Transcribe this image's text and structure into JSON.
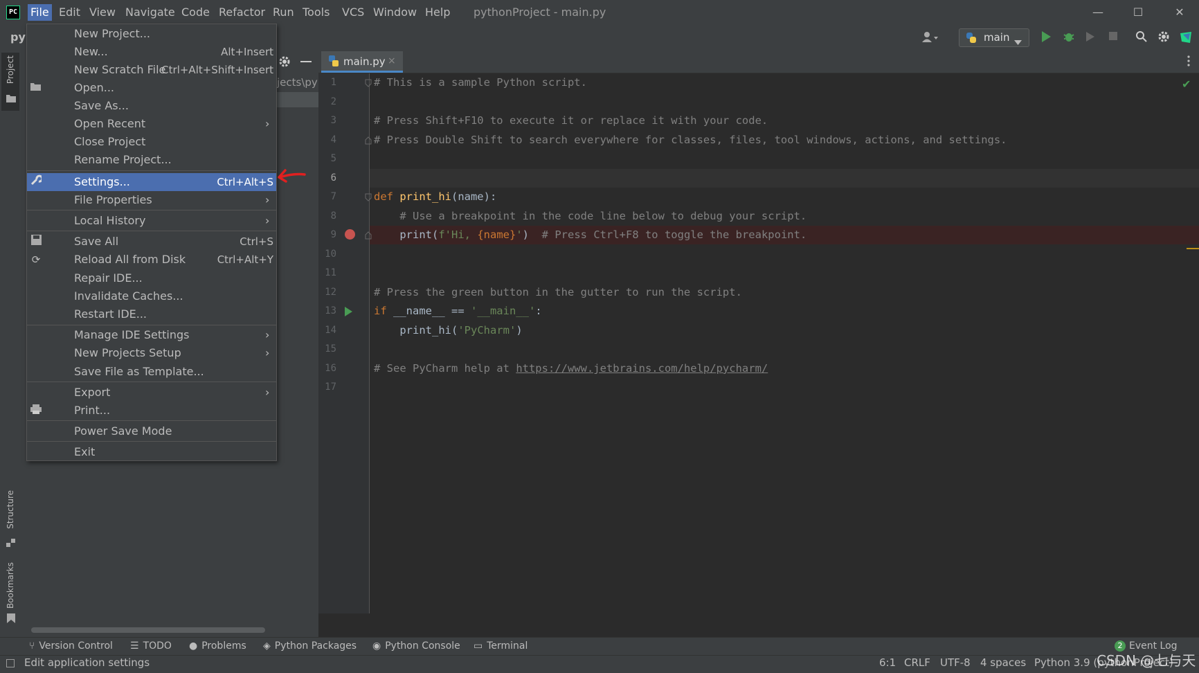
{
  "titlebar": {
    "logo": "PC",
    "menus": [
      "File",
      "Edit",
      "View",
      "Navigate",
      "Code",
      "Refactor",
      "Run",
      "Tools",
      "VCS",
      "Window",
      "Help"
    ],
    "window_title": "pythonProject - main.py",
    "minimize": "—",
    "maximize": "☐",
    "close": "✕"
  },
  "toolbar": {
    "project_short": "py",
    "run_config": "main",
    "icons": [
      "user-icon",
      "python-icon",
      "run-icon",
      "debug-icon",
      "coverage-icon",
      "stop-icon",
      "search-icon",
      "gear-icon",
      "jetbrains-toolbox-icon"
    ]
  },
  "left_stripe": {
    "project": "Project",
    "structure": "Structure",
    "bookmarks": "Bookmarks"
  },
  "project_panel": {
    "path": "jects\\py"
  },
  "editor": {
    "tab_label": "main.py",
    "tab_close": "×",
    "line_numbers": [
      "1",
      "2",
      "3",
      "4",
      "5",
      "6",
      "7",
      "8",
      "9",
      "10",
      "11",
      "12",
      "13",
      "14",
      "15",
      "16",
      "17"
    ],
    "current_line": 6,
    "breakpoint_line": 9,
    "run_line": 13,
    "lines": {
      "l1": "# This is a sample Python script.",
      "l3": "# Press Shift+F10 to execute it or replace it with your code.",
      "l4": "# Press Double Shift to search everywhere for classes, files, tool windows, actions, and settings.",
      "l7_kw": "def ",
      "l7_fn": "print_hi",
      "l7_rest": "(name):",
      "l8": "    # Use a breakpoint in the code line below to debug your script.",
      "l9_a": "    print(",
      "l9_str1": "f'Hi, ",
      "l9_name": "{name}",
      "l9_str2": "'",
      "l9_b": ")  ",
      "l9_cm": "# Press Ctrl+F8 to toggle the breakpoint.",
      "l12": "# Press the green button in the gutter to run the script.",
      "l13_kw": "if ",
      "l13_mid": "__name__ == ",
      "l13_str": "'__main__'",
      "l13_end": ":",
      "l14_a": "    print_hi(",
      "l14_str": "'PyCharm'",
      "l14_b": ")",
      "l16_cm": "# See PyCharm help at ",
      "l16_url": "https://www.jetbrains.com/help/pycharm/"
    }
  },
  "file_menu": {
    "items": [
      {
        "label": "New Project...",
        "shortcut": "",
        "submenu": false
      },
      {
        "label": "New...",
        "shortcut": "Alt+Insert",
        "submenu": false
      },
      {
        "label": "New Scratch File",
        "shortcut": "Ctrl+Alt+Shift+Insert",
        "submenu": false
      },
      {
        "label": "Open...",
        "shortcut": "",
        "submenu": false,
        "icon": "folder-icon"
      },
      {
        "label": "Save As...",
        "shortcut": "",
        "submenu": false
      },
      {
        "label": "Open Recent",
        "shortcut": "",
        "submenu": true
      },
      {
        "label": "Close Project",
        "shortcut": "",
        "submenu": false
      },
      {
        "label": "Rename Project...",
        "shortcut": "",
        "submenu": false
      },
      {
        "label": "Settings...",
        "shortcut": "Ctrl+Alt+S",
        "submenu": false,
        "icon": "wrench-icon",
        "selected": true
      },
      {
        "label": "File Properties",
        "shortcut": "",
        "submenu": true
      },
      {
        "label": "Local History",
        "shortcut": "",
        "submenu": true
      },
      {
        "label": "Save All",
        "shortcut": "Ctrl+S",
        "submenu": false,
        "icon": "save-icon"
      },
      {
        "label": "Reload All from Disk",
        "shortcut": "Ctrl+Alt+Y",
        "submenu": false,
        "icon": "reload-icon"
      },
      {
        "label": "Repair IDE...",
        "shortcut": "",
        "submenu": false
      },
      {
        "label": "Invalidate Caches...",
        "shortcut": "",
        "submenu": false
      },
      {
        "label": "Restart IDE...",
        "shortcut": "",
        "submenu": false
      },
      {
        "label": "Manage IDE Settings",
        "shortcut": "",
        "submenu": true
      },
      {
        "label": "New Projects Setup",
        "shortcut": "",
        "submenu": true
      },
      {
        "label": "Save File as Template...",
        "shortcut": "",
        "submenu": false
      },
      {
        "label": "Export",
        "shortcut": "",
        "submenu": true
      },
      {
        "label": "Print...",
        "shortcut": "",
        "submenu": false,
        "icon": "print-icon"
      },
      {
        "label": "Power Save Mode",
        "shortcut": "",
        "submenu": false
      },
      {
        "label": "Exit",
        "shortcut": "",
        "submenu": false
      }
    ],
    "submenu_arrow": "›"
  },
  "bottom_bar": {
    "tabs": [
      {
        "label": "Version Control",
        "icon": "version-control-icon"
      },
      {
        "label": "TODO",
        "icon": "todo-icon"
      },
      {
        "label": "Problems",
        "icon": "problems-icon"
      },
      {
        "label": "Python Packages",
        "icon": "packages-icon"
      },
      {
        "label": "Python Console",
        "icon": "python-console-icon"
      },
      {
        "label": "Terminal",
        "icon": "terminal-icon"
      }
    ],
    "event_log": "Event Log",
    "event_count": "2"
  },
  "status_bar": {
    "message": "Edit application settings",
    "position": "6:1",
    "line_sep": "CRLF",
    "encoding": "UTF-8",
    "indent": "4 spaces",
    "interpreter": "Python 3.9 (pythonProject)"
  },
  "watermark": "CSDN @七与天",
  "colors": {
    "menu_selected": "#4b6eaf",
    "breakpoint": "#c75450",
    "run": "#499c54",
    "annotation_arrow": "#e02020"
  }
}
